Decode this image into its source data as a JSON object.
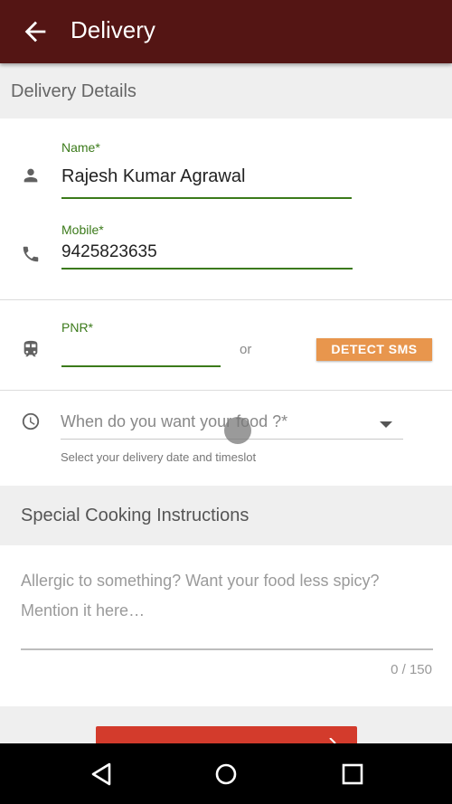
{
  "appbar": {
    "title": "Delivery",
    "back_icon": "arrow-back-icon",
    "color": "#541514"
  },
  "delivery_details": {
    "header": "Delivery Details",
    "name": {
      "label": "Name*",
      "value": "Rajesh Kumar Agrawal",
      "icon": "person-icon"
    },
    "mobile": {
      "label": "Mobile*",
      "value": "9425823635",
      "icon": "phone-icon"
    },
    "pnr": {
      "label": "PNR*",
      "value": "",
      "icon": "train-icon",
      "or_text": "or",
      "detect_button": "DETECT SMS"
    },
    "time": {
      "placeholder": "When do you want your food ?*",
      "helper": "Select your delivery date and timeslot",
      "icon": "clock-icon"
    }
  },
  "special_instructions": {
    "header": "Special Cooking Instructions",
    "placeholder": "Allergic to something? Want your food less spicy? Mention it here…",
    "counter": "0 / 150"
  },
  "colors": {
    "accent_green": "#3b7a1a",
    "detect_button": "#e8964d",
    "cta": "#d33b2c"
  },
  "navbar": {
    "back": "nav-back-icon",
    "home": "nav-home-icon",
    "recents": "nav-recents-icon"
  }
}
